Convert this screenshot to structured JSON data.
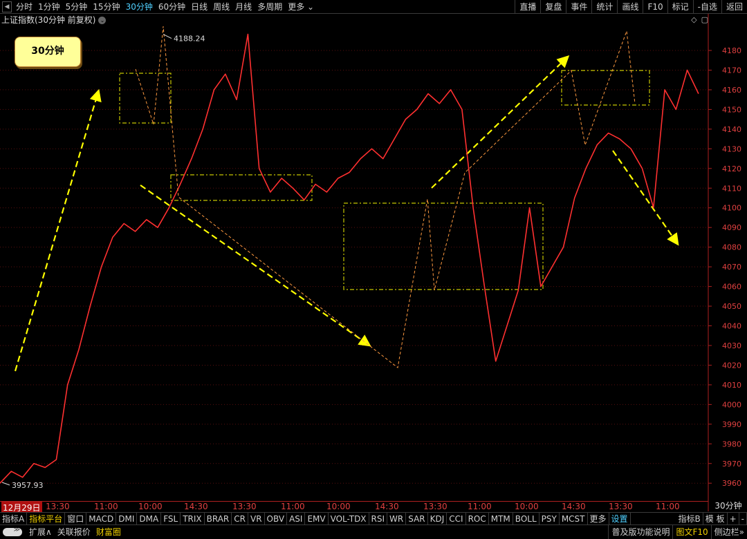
{
  "toolbar": {
    "periods": [
      "分时",
      "1分钟",
      "5分钟",
      "15分钟",
      "30分钟",
      "60分钟",
      "日线",
      "周线",
      "月线",
      "多周期",
      "更多"
    ],
    "active_period": "30分钟",
    "right_buttons": [
      "直播",
      "复盘",
      "事件",
      "统计",
      "画线",
      "F10",
      "标记",
      "-自选",
      "返回"
    ]
  },
  "chart_title": "上证指数(30分钟 前复权)",
  "badge_label": "30分钟",
  "annotations": {
    "high_label": "4188.24",
    "low_label": "3957.93"
  },
  "colors": {
    "price_line": "#ff3030",
    "annotation": "#ffff00",
    "axis": "#b02020",
    "background": "#000000"
  },
  "chart_data": {
    "type": "line",
    "title": "上证指数(30分钟 前复权)",
    "xlabel": "",
    "ylabel": "",
    "ylim": [
      3952,
      4193
    ],
    "y_ticks": [
      3960,
      3970,
      3980,
      3990,
      4000,
      4010,
      4020,
      4030,
      4040,
      4050,
      4060,
      4070,
      4080,
      4090,
      4100,
      4110,
      4120,
      4130,
      4140,
      4150,
      4160,
      4170,
      4180
    ],
    "x_labels": [
      "12月29日",
      "13:30",
      "11:00",
      "10:00",
      "14:30",
      "13:30",
      "11:00",
      "10:00",
      "14:30",
      "13:30",
      "11:00",
      "10:00",
      "14:30",
      "13:30",
      "11:00"
    ],
    "points_count": 250,
    "x": [
      0,
      4,
      8,
      12,
      16,
      20,
      24,
      28,
      32,
      36,
      40,
      44,
      48,
      52,
      56,
      60,
      64,
      68,
      72,
      76,
      80,
      84,
      88,
      92,
      96,
      100,
      104,
      108,
      112,
      116,
      120,
      124,
      128,
      132,
      136,
      140,
      144,
      148,
      152,
      156,
      160,
      164,
      168,
      172,
      176,
      180,
      184,
      188,
      192,
      196,
      200,
      204,
      208,
      212,
      216,
      220,
      224,
      228,
      232,
      236,
      240,
      244,
      248
    ],
    "series": [
      {
        "values": [
          3960,
          3966,
          3963,
          3970,
          3968,
          3972,
          4010,
          4028,
          4050,
          4070,
          4085,
          4092,
          4088,
          4094,
          4090,
          4100,
          4112,
          4125,
          4140,
          4160,
          4168,
          4155,
          4188.24,
          4120,
          4108,
          4115,
          4110,
          4104,
          4112,
          4108,
          4115,
          4118,
          4125,
          4130,
          4125,
          4135,
          4145,
          4150,
          4158,
          4153,
          4160,
          4150,
          4100,
          4060,
          4022,
          4040,
          4058,
          4100,
          4060,
          4070,
          4080,
          4105,
          4120,
          4132,
          4138,
          4135,
          4130,
          4120,
          4100,
          4160,
          4150,
          4170,
          4158
        ]
      }
    ]
  }
}
